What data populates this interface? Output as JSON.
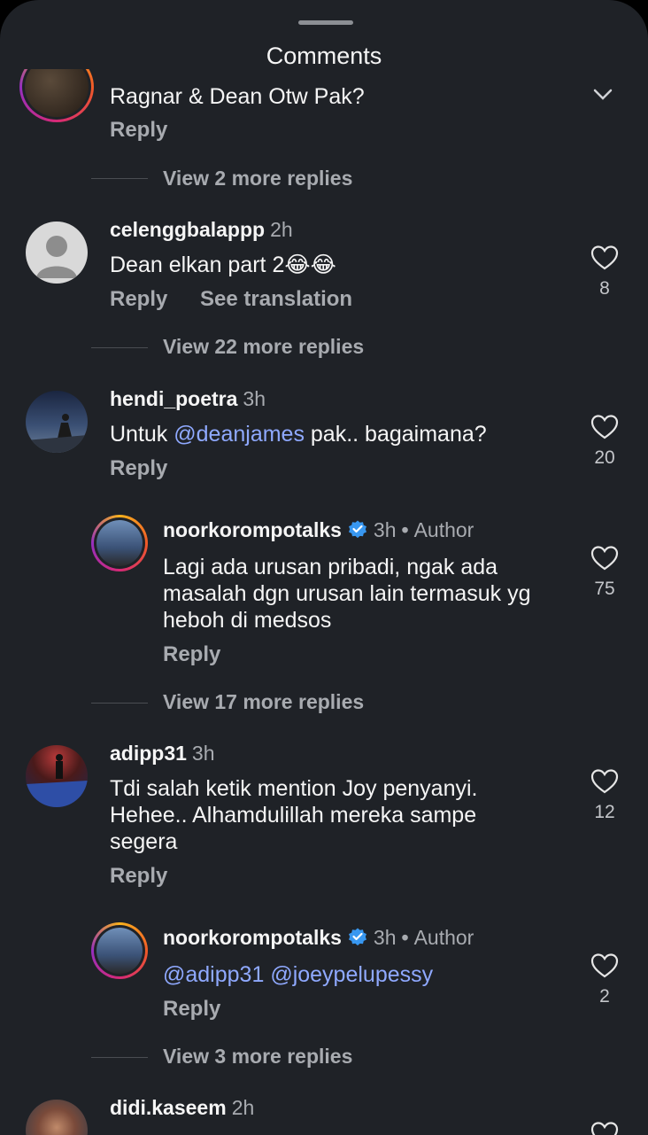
{
  "header": {
    "title": "Comments"
  },
  "prev_comment": {
    "text_partial": "Ragnar & Dean Otw Pak?",
    "reply_label": "Reply",
    "view_more": "View 2 more replies"
  },
  "comments": [
    {
      "username": "celenggbalappp",
      "time": "2h",
      "text_parts": [
        "Dean elkan part 2😂😂"
      ],
      "reply_label": "Reply",
      "translate_label": "See translation",
      "likes": "8",
      "view_more": "View 22 more replies"
    },
    {
      "username": "hendi_poetra",
      "time": "3h",
      "text_before": "Untuk ",
      "mention": "@deanjames",
      "text_after": " pak.. bagaimana?",
      "reply_label": "Reply",
      "likes": "20"
    },
    {
      "username": "noorkorompotalks",
      "time": "3h",
      "badge": "Author",
      "text": "Lagi ada urusan pribadi, ngak ada masalah dgn urusan lain termasuk yg heboh di medsos",
      "reply_label": "Reply",
      "likes": "75",
      "view_more": "View 17 more replies"
    },
    {
      "username": "adipp31",
      "time": "3h",
      "text": "Tdi salah ketik mention Joy penyanyi. Hehee.. Alhamdulillah mereka sampe segera",
      "reply_label": "Reply",
      "likes": "12"
    },
    {
      "username": "noorkorompotalks",
      "time": "3h",
      "badge": "Author",
      "mention1": "@adipp31",
      "mention2": "@joeypelupessy",
      "reply_label": "Reply",
      "likes": "2",
      "view_more": "View 3 more replies"
    },
    {
      "username": "didi.kaseem",
      "time": "2h"
    }
  ],
  "separator": "•",
  "icons": {
    "like": "heart-outline-icon",
    "verified": "verified-badge-icon",
    "collapse": "chevron-down-icon"
  },
  "colors": {
    "background": "#1f2227",
    "mention": "#8fa9ff",
    "verified": "#3897f0",
    "secondary_text": "#a8abb0"
  }
}
